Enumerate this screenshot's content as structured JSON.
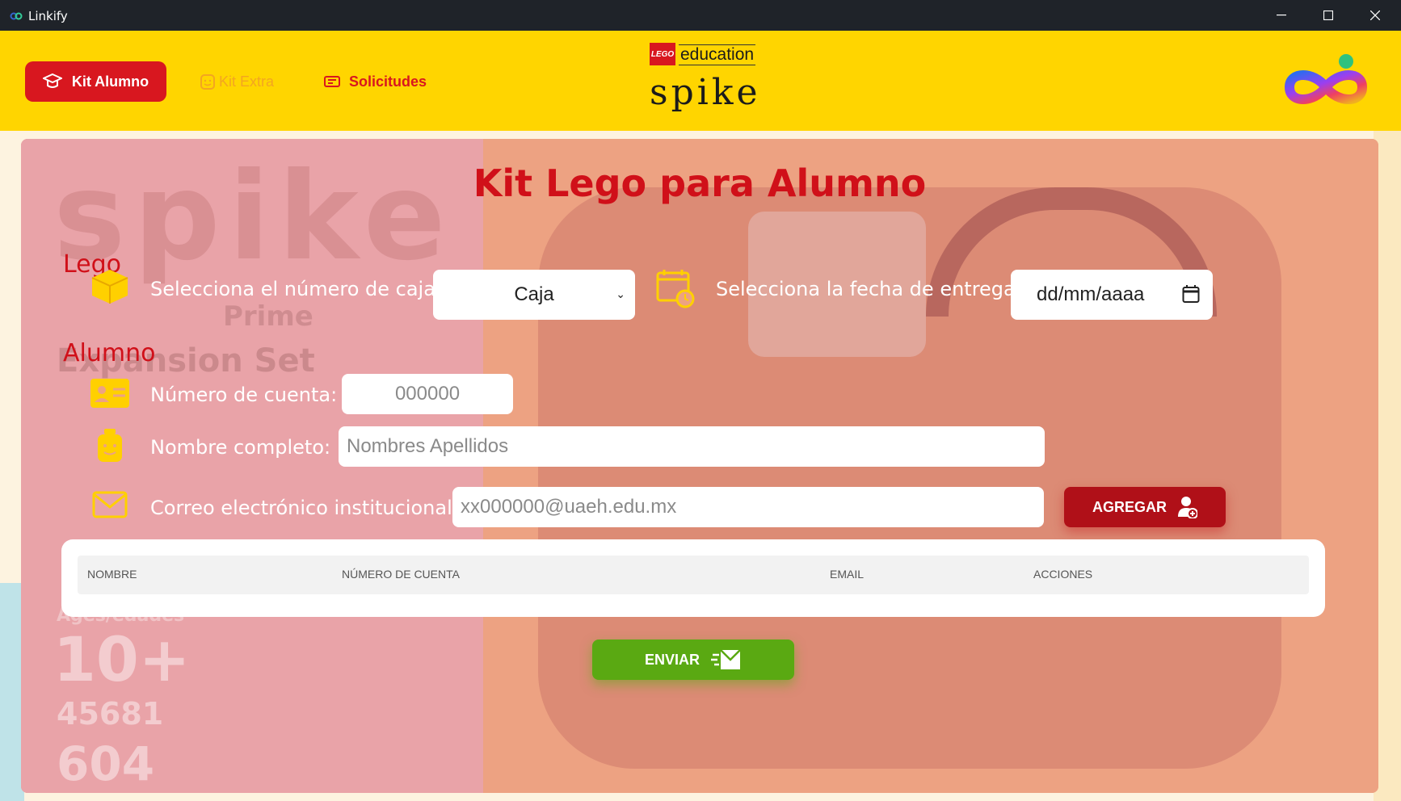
{
  "window": {
    "title": "Linkify"
  },
  "nav": {
    "kit_alumno": "Kit Alumno",
    "kit_extra": "Kit Extra",
    "solicitudes": "Solicitudes"
  },
  "brand": {
    "lego_badge": "LEGO",
    "education": "education",
    "spike": "spike"
  },
  "main": {
    "title": "Kit Lego para Alumno",
    "section_lego": "Lego",
    "section_alumno": "Alumno",
    "caja_label": "Selecciona el número de caja:",
    "caja_value": "Caja",
    "fecha_label": "Selecciona la fecha de entrega:",
    "fecha_value": "dd/mm/aaaa",
    "cuenta_label": "Número de cuenta:",
    "cuenta_placeholder": "000000",
    "nombre_label": "Nombre completo:",
    "nombre_placeholder": "Nombres Apellidos",
    "correo_label": "Correo electrónico institucional:",
    "correo_placeholder": "xx000000@uaeh.edu.mx",
    "agregar_label": "AGREGAR",
    "enviar_label": "ENVIAR"
  },
  "table": {
    "headers": [
      "NOMBRE",
      "NÚMERO DE CUENTA",
      "EMAIL",
      "ACCIONES"
    ]
  },
  "background": {
    "spike": "spike",
    "prime": "Prime",
    "set": "Expansion Set",
    "ages": "Ages/edades",
    "age": "10+",
    "set_number": "45681",
    "pieces": "604"
  },
  "colors": {
    "header_yellow": "#ffd500",
    "brand_red": "#d8171f",
    "agregar_red": "#b01018",
    "enviar_green": "#5aa912",
    "extra_orange": "#f3a521"
  }
}
